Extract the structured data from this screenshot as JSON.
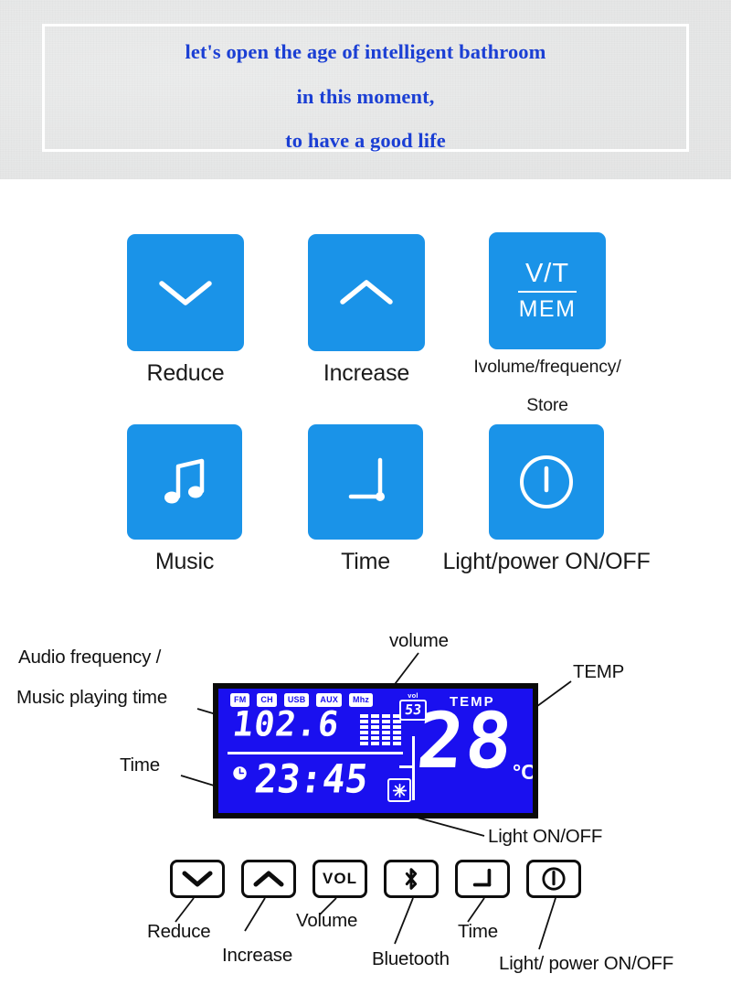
{
  "banner": {
    "lines": [
      "let's open the age of intelligent bathroom",
      "in this moment,",
      "to have a good life"
    ],
    "text_color": "#1b3fd4",
    "background_color": "#e8e9e9"
  },
  "keypad": {
    "accent_color": "#1a93e8",
    "buttons": [
      {
        "icon": "chevron-down-icon",
        "label": "Reduce"
      },
      {
        "icon": "chevron-up-icon",
        "label": "Increase"
      },
      {
        "icon": "vt-mem-icon",
        "glyph_top": "V/T",
        "glyph_bottom": "MEM",
        "label_line1": "Ivolume/frequency/",
        "label_line2": "Store"
      },
      {
        "icon": "music-note-icon",
        "label": "Music"
      },
      {
        "icon": "clock-hands-icon",
        "label": "Time"
      },
      {
        "icon": "power-icon",
        "label": "Light/power ON/OFF"
      }
    ]
  },
  "lcd": {
    "background_color": "#1a10ef",
    "segment_color": "#ffffff",
    "bezel_color": "#0a0a0a",
    "tags": [
      "FM",
      "CH",
      "USB",
      "AUX",
      "Mhz"
    ],
    "frequency": "102.6",
    "volume_label": "vol",
    "volume_value": "53",
    "temp_label": "TEMP",
    "temp_value": "28",
    "temp_unit": "°C",
    "time_value": "23:45",
    "bargraph_columns": 4,
    "bargraph_rows": 6
  },
  "callouts": [
    {
      "name": "audio-frequency-callout",
      "line1": "Audio frequency /",
      "line2": "Music playing time"
    },
    {
      "name": "time-callout",
      "text": "Time"
    },
    {
      "name": "volume-callout",
      "text": "volume"
    },
    {
      "name": "temp-callout",
      "text": "TEMP"
    },
    {
      "name": "light-onoff-callout",
      "text": "Light ON/OFF"
    }
  ],
  "bottom_buttons": [
    {
      "icon": "chevron-down-icon",
      "label": "Reduce"
    },
    {
      "icon": "chevron-up-icon",
      "label": "Increase"
    },
    {
      "icon": "vol-text-icon",
      "glyph": "VOL",
      "label": "Volume"
    },
    {
      "icon": "bluetooth-icon",
      "label": "Bluetooth"
    },
    {
      "icon": "clock-hands-icon",
      "label": "Time"
    },
    {
      "icon": "power-icon",
      "label": "Light/ power ON/OFF"
    }
  ]
}
